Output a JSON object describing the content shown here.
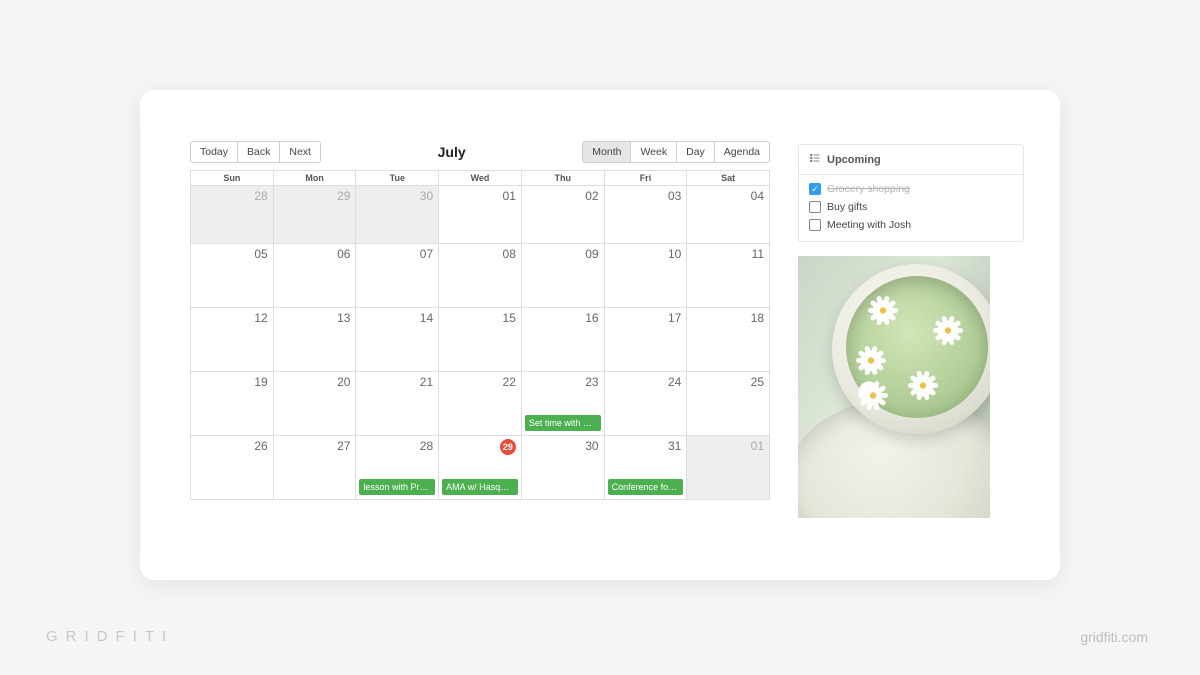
{
  "nav": {
    "today": "Today",
    "back": "Back",
    "next": "Next"
  },
  "title": "July",
  "views": {
    "month": "Month",
    "week": "Week",
    "day": "Day",
    "agenda": "Agenda",
    "active": "month"
  },
  "dow": [
    "Sun",
    "Mon",
    "Tue",
    "Wed",
    "Thu",
    "Fri",
    "Sat"
  ],
  "weeks": [
    [
      {
        "n": "28",
        "off": true
      },
      {
        "n": "29",
        "off": true
      },
      {
        "n": "30",
        "off": true
      },
      {
        "n": "01"
      },
      {
        "n": "02"
      },
      {
        "n": "03"
      },
      {
        "n": "04"
      }
    ],
    [
      {
        "n": "05"
      },
      {
        "n": "06"
      },
      {
        "n": "07"
      },
      {
        "n": "08"
      },
      {
        "n": "09"
      },
      {
        "n": "10"
      },
      {
        "n": "11"
      }
    ],
    [
      {
        "n": "12"
      },
      {
        "n": "13"
      },
      {
        "n": "14"
      },
      {
        "n": "15"
      },
      {
        "n": "16"
      },
      {
        "n": "17"
      },
      {
        "n": "18"
      }
    ],
    [
      {
        "n": "19"
      },
      {
        "n": "20"
      },
      {
        "n": "21"
      },
      {
        "n": "22"
      },
      {
        "n": "23",
        "event": "Set time with Li…"
      },
      {
        "n": "24"
      },
      {
        "n": "25"
      }
    ],
    [
      {
        "n": "26"
      },
      {
        "n": "27"
      },
      {
        "n": "28",
        "event": "lesson with Prof…"
      },
      {
        "n": "29",
        "today": true,
        "event": "AMA w/ Hasque…"
      },
      {
        "n": "30"
      },
      {
        "n": "31",
        "event": "Conference for …"
      },
      {
        "n": "01",
        "off": true
      }
    ]
  ],
  "upcoming": {
    "title": "Upcoming",
    "items": [
      {
        "label": "Grocery shopping",
        "done": true
      },
      {
        "label": "Buy gifts",
        "done": false
      },
      {
        "label": "Meeting with Josh",
        "done": false
      }
    ]
  },
  "watermark": {
    "left": "GRIDFITI",
    "right": "gridfiti.com"
  }
}
